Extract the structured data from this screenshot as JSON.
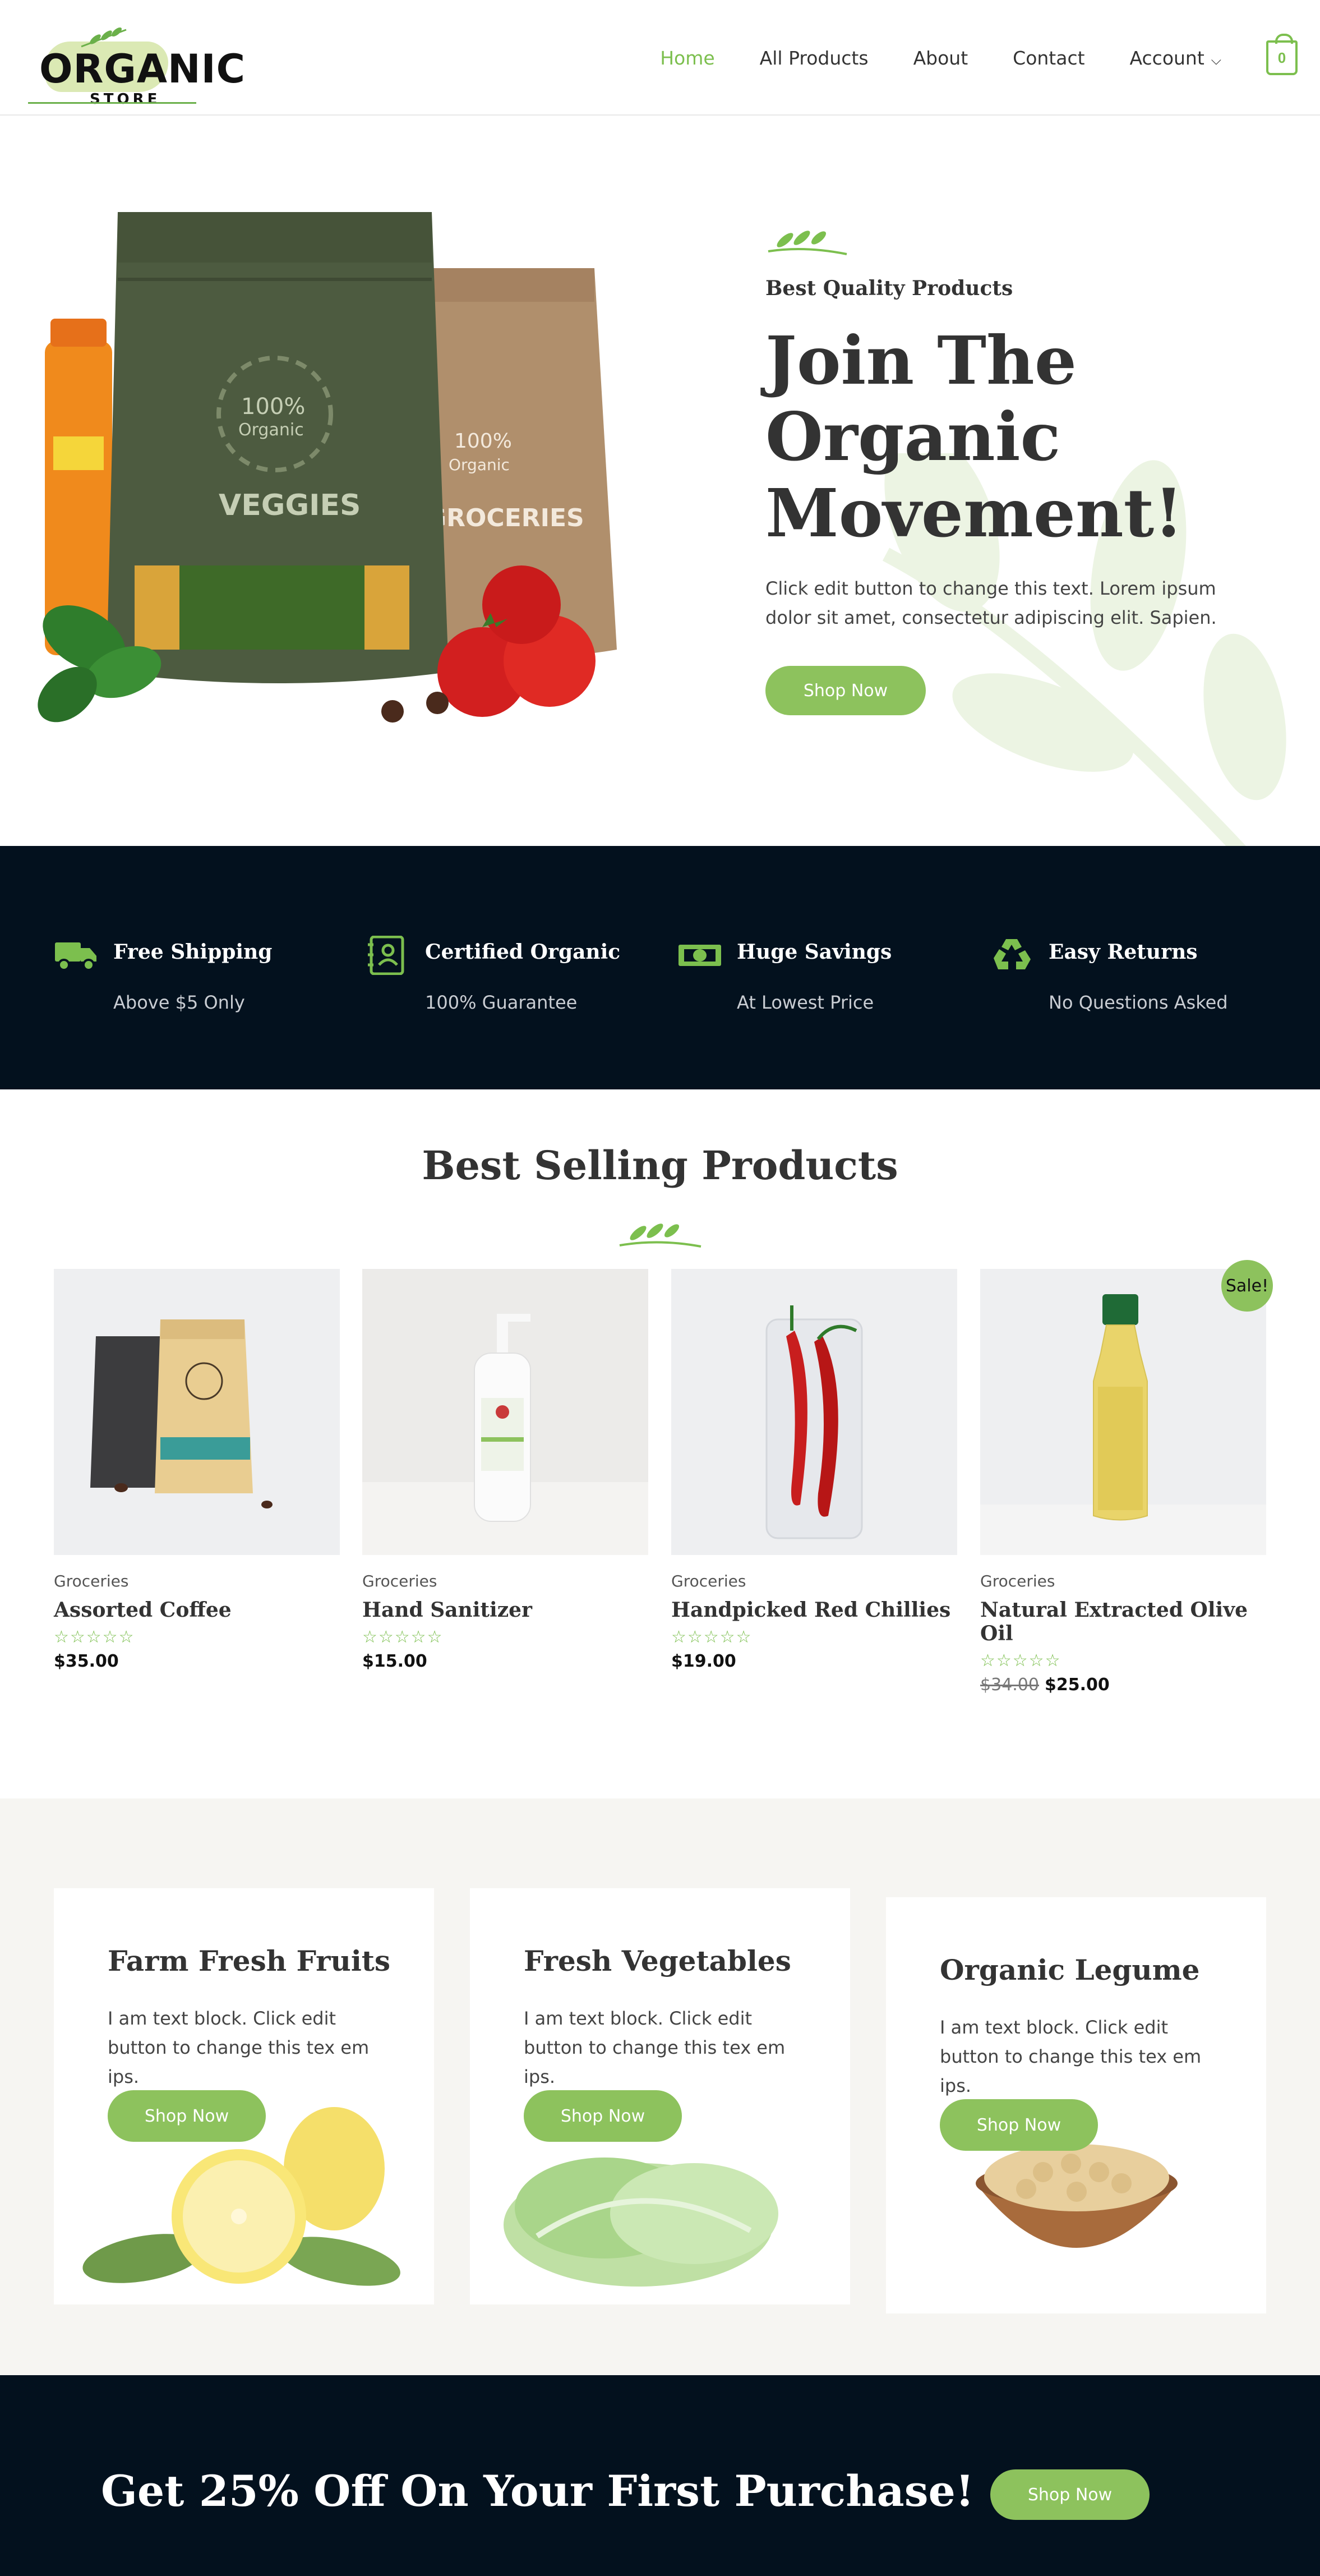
{
  "header": {
    "logo_text": "ORGANIC",
    "logo_subtext": "STORE",
    "nav": [
      {
        "label": "Home",
        "active": true
      },
      {
        "label": "All Products",
        "active": false
      },
      {
        "label": "About",
        "active": false
      },
      {
        "label": "Contact",
        "active": false
      },
      {
        "label": "Account",
        "active": false
      }
    ],
    "cart_count": "0"
  },
  "hero": {
    "eyebrow": "Best Quality Products",
    "title_line1": "Join The",
    "title_line2": "Organic",
    "title_line3": "Movement!",
    "description": "Click edit button to change this text. Lorem ipsum dolor sit amet, consectetur adipiscing elit. Sapien.",
    "button": "Shop Now",
    "bag_left_badge_line1": "100%",
    "bag_left_badge_line2": "Organic",
    "bag_left_label": "VEGGIES",
    "bag_right_badge_line1": "100%",
    "bag_right_badge_line2": "Organic",
    "bag_right_label": "GROCERIES"
  },
  "features": [
    {
      "icon": "truck-icon",
      "title": "Free Shipping",
      "subtitle": "Above $5 Only"
    },
    {
      "icon": "certificate-icon",
      "title": "Certified Organic",
      "subtitle": "100% Guarantee"
    },
    {
      "icon": "money-icon",
      "title": "Huge Savings",
      "subtitle": "At Lowest Price"
    },
    {
      "icon": "recycle-icon",
      "title": "Easy Returns",
      "subtitle": "No Questions Asked"
    }
  ],
  "products": {
    "heading": "Best Selling Products",
    "sale_badge": "Sale!",
    "items": [
      {
        "category": "Groceries",
        "name": "Assorted Coffee",
        "stars": "☆☆☆☆☆",
        "price": "$35.00",
        "old_price": ""
      },
      {
        "category": "Groceries",
        "name": "Hand Sanitizer",
        "stars": "☆☆☆☆☆",
        "price": "$15.00",
        "old_price": ""
      },
      {
        "category": "Groceries",
        "name": "Handpicked Red Chillies",
        "stars": "☆☆☆☆☆",
        "price": "$19.00",
        "old_price": ""
      },
      {
        "category": "Groceries",
        "name": "Natural Extracted Olive Oil",
        "stars": "☆☆☆☆☆",
        "price": "$25.00",
        "old_price": "$34.00"
      }
    ]
  },
  "categories": [
    {
      "title": "Farm Fresh Fruits",
      "description": "I am text block. Click edit button to change this tex em ips.",
      "button": "Shop Now"
    },
    {
      "title": "Fresh Vegetables",
      "description": "I am text block. Click edit button to change this tex em ips.",
      "button": "Shop Now"
    },
    {
      "title": "Organic Legume",
      "description": "I am text block. Click edit button to change this tex em ips.",
      "button": "Shop Now"
    }
  ],
  "cta": {
    "title": "Get 25% Off On Your First Purchase!",
    "button": "Shop Now"
  },
  "colors": {
    "accent": "#8dc25d",
    "nav_active": "#7cbf4e",
    "dark_band": "#03111e",
    "cards_bg": "#f6f5f2"
  }
}
